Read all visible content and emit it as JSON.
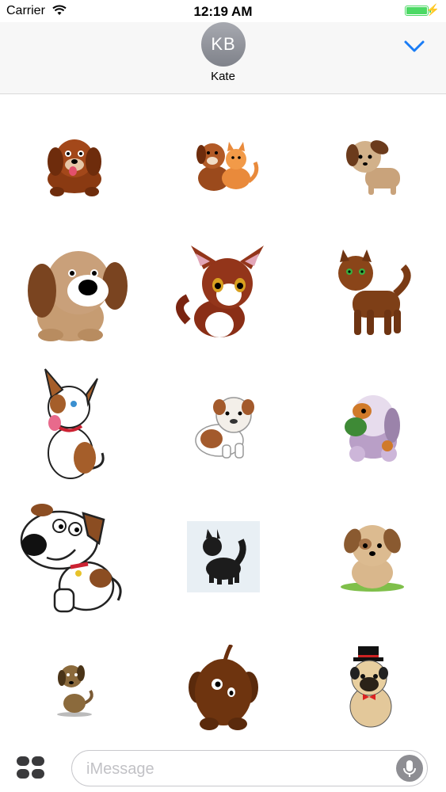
{
  "status_bar": {
    "carrier": "Carrier",
    "time": "12:19 AM"
  },
  "header": {
    "avatar_initials": "KB",
    "contact_name": "Kate"
  },
  "stickers": [
    {
      "label": "brown-puppy-sticker"
    },
    {
      "label": "puppy-and-kitten-sticker"
    },
    {
      "label": "tan-puppy-sticker"
    },
    {
      "label": "big-eared-puppy-sticker"
    },
    {
      "label": "red-kitten-sticker"
    },
    {
      "label": "green-eyed-puppy-sticker"
    },
    {
      "label": "jack-russell-sticker"
    },
    {
      "label": "bulldog-puppy-sticker"
    },
    {
      "label": "plush-puppy-sticker"
    },
    {
      "label": "white-spotted-dog-sticker"
    },
    {
      "label": "black-puppy-sticker"
    },
    {
      "label": "puppy-on-grass-sticker"
    },
    {
      "label": "small-dachshund-sticker"
    },
    {
      "label": "round-brown-dog-sticker"
    },
    {
      "label": "pug-with-hat-sticker"
    }
  ],
  "compose": {
    "placeholder": "iMessage"
  }
}
